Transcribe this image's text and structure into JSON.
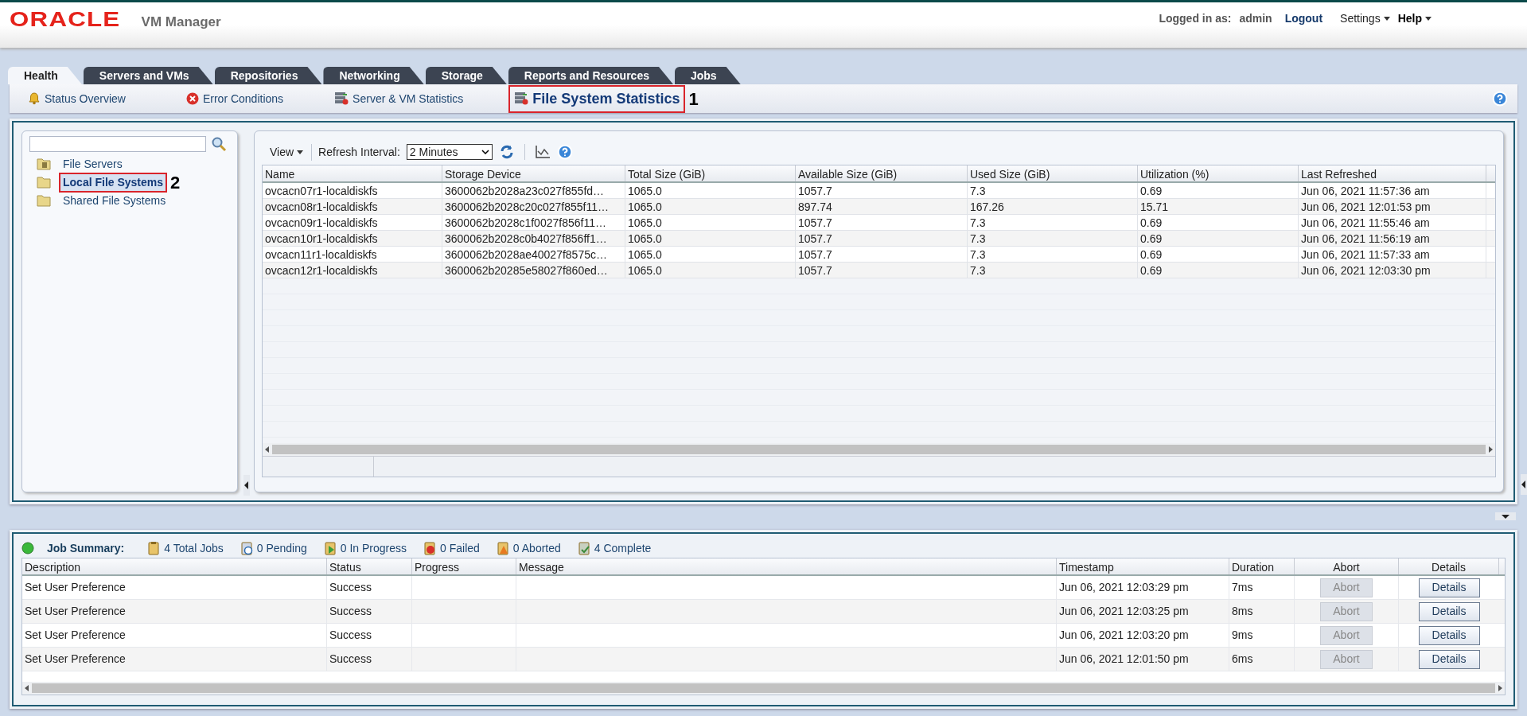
{
  "header": {
    "logo": "ORACLE",
    "product": "VM Manager",
    "logged_in_label": "Logged in as:",
    "user": "admin",
    "logout": "Logout",
    "menus": [
      {
        "label": "Settings",
        "emphasized": false
      },
      {
        "label": "Help",
        "emphasized": true
      }
    ]
  },
  "tabs": [
    {
      "label": "Health",
      "selected": true
    },
    {
      "label": "Servers and VMs",
      "selected": false
    },
    {
      "label": "Repositories",
      "selected": false
    },
    {
      "label": "Networking",
      "selected": false
    },
    {
      "label": "Storage",
      "selected": false
    },
    {
      "label": "Reports and Resources",
      "selected": false
    },
    {
      "label": "Jobs",
      "selected": false
    }
  ],
  "subnav": [
    {
      "label": "Status Overview",
      "kind": "bell",
      "selected": false
    },
    {
      "label": "Error Conditions",
      "kind": "error",
      "selected": false
    },
    {
      "label": "Server & VM Statistics",
      "kind": "stats",
      "selected": false
    },
    {
      "label": "File System Statistics",
      "kind": "stats",
      "selected": true,
      "callout": "1"
    }
  ],
  "tree": [
    {
      "label": "File Servers",
      "kind": "server_folder",
      "selected": false
    },
    {
      "label": "Local File Systems",
      "kind": "folder",
      "selected": true,
      "callout": "2"
    },
    {
      "label": "Shared File Systems",
      "kind": "folder",
      "selected": false
    }
  ],
  "toolbar": {
    "view_menu": "View",
    "refresh_label": "Refresh Interval:",
    "refresh_value": "2 Minutes"
  },
  "table": {
    "columns": [
      "Name",
      "Storage Device",
      "Total Size (GiB)",
      "Available Size (GiB)",
      "Used Size (GiB)",
      "Utilization (%)",
      "Last Refreshed"
    ],
    "rows": [
      [
        "ovcacn07r1-localdiskfs",
        "3600062b2028a23c027f855fd…",
        "1065.0",
        "1057.7",
        "7.3",
        "0.69",
        "Jun 06, 2021 11:57:36 am"
      ],
      [
        "ovcacn08r1-localdiskfs",
        "3600062b2028c20c027f855f11…",
        "1065.0",
        "897.74",
        "167.26",
        "15.71",
        "Jun 06, 2021 12:01:53 pm"
      ],
      [
        "ovcacn09r1-localdiskfs",
        "3600062b2028c1f0027f856f11…",
        "1065.0",
        "1057.7",
        "7.3",
        "0.69",
        "Jun 06, 2021 11:55:46 am"
      ],
      [
        "ovcacn10r1-localdiskfs",
        "3600062b2028c0b4027f856ff1…",
        "1065.0",
        "1057.7",
        "7.3",
        "0.69",
        "Jun 06, 2021 11:56:19 am"
      ],
      [
        "ovcacn11r1-localdiskfs",
        "3600062b2028ae40027f8575c…",
        "1065.0",
        "1057.7",
        "7.3",
        "0.69",
        "Jun 06, 2021 11:57:33 am"
      ],
      [
        "ovcacn12r1-localdiskfs",
        "3600062b20285e58027f860ed…",
        "1065.0",
        "1057.7",
        "7.3",
        "0.69",
        "Jun 06, 2021 12:03:30 pm"
      ]
    ]
  },
  "jobs": {
    "title": "Job Summary:",
    "counts": [
      {
        "kind": "total",
        "label": "4 Total Jobs"
      },
      {
        "kind": "pending",
        "label": "0 Pending"
      },
      {
        "kind": "progress",
        "label": "0 In Progress"
      },
      {
        "kind": "failed",
        "label": "0 Failed"
      },
      {
        "kind": "aborted",
        "label": "0 Aborted"
      },
      {
        "kind": "complete",
        "label": "4 Complete"
      }
    ],
    "columns": [
      "Description",
      "Status",
      "Progress",
      "Message",
      "Timestamp",
      "Duration",
      "Abort",
      "Details"
    ],
    "rows": [
      {
        "description": "Set User Preference",
        "status": "Success",
        "timestamp": "Jun 06, 2021 12:03:29 pm",
        "duration": "7ms",
        "abort": "Abort",
        "abort_disabled": true,
        "details": "Details"
      },
      {
        "description": "Set User Preference",
        "status": "Success",
        "timestamp": "Jun 06, 2021 12:03:25 pm",
        "duration": "8ms",
        "abort": "Abort",
        "abort_disabled": true,
        "details": "Details"
      },
      {
        "description": "Set User Preference",
        "status": "Success",
        "timestamp": "Jun 06, 2021 12:03:20 pm",
        "duration": "9ms",
        "abort": "Abort",
        "abort_disabled": true,
        "details": "Details"
      },
      {
        "description": "Set User Preference",
        "status": "Success",
        "timestamp": "Jun 06, 2021 12:01:50 pm",
        "duration": "6ms",
        "abort": "Abort",
        "abort_disabled": true,
        "details": "Details"
      }
    ]
  }
}
